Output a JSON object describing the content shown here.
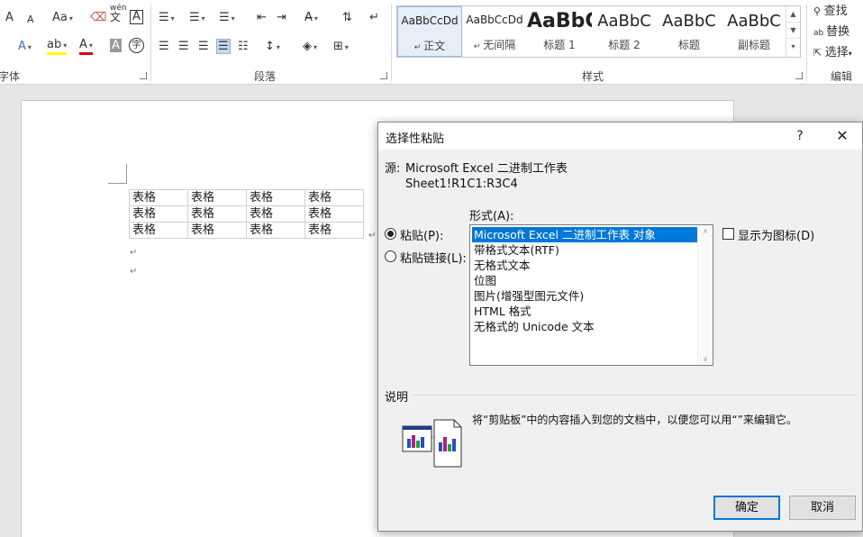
{
  "ribbon": {
    "group_labels": {
      "font": "字体",
      "paragraph": "段落",
      "styles": "样式",
      "editing": "编辑"
    },
    "font_controls": {
      "grow": "A",
      "shrink": "A",
      "case": "Aa",
      "phonetic_top": "wén",
      "phonetic_bottom": "文",
      "border_char": "A",
      "text_effects": "A",
      "highlight": "ab",
      "font_color": "A",
      "char_shading": "A",
      "enclose": "字"
    },
    "styles": [
      {
        "sample": "AaBbCcDd",
        "name": "正文",
        "selected": true
      },
      {
        "sample": "AaBbCcDd",
        "name": "无间隔",
        "selected": false
      },
      {
        "sample": "AaBbC",
        "name": "标题 1",
        "selected": false
      },
      {
        "sample": "AaBbC",
        "name": "标题 2",
        "selected": false
      },
      {
        "sample": "AaBbC",
        "name": "标题",
        "selected": false
      },
      {
        "sample": "AaBbC",
        "name": "副标题",
        "selected": false
      }
    ],
    "editing": {
      "find": "查找",
      "replace": "替换",
      "select": "选择"
    }
  },
  "document": {
    "table": [
      [
        "表格",
        "表格",
        "表格",
        "表格"
      ],
      [
        "表格",
        "表格",
        "表格",
        "表格"
      ],
      [
        "表格",
        "表格",
        "表格",
        "表格"
      ]
    ],
    "paragraph_mark": "↵"
  },
  "dialog": {
    "title": "选择性粘贴",
    "help": "?",
    "close": "✕",
    "source_label": "源:",
    "source_value": "Microsoft Excel 二进制工作表",
    "source_range": "Sheet1!R1C1:R3C4",
    "format_label": "形式(A):",
    "paste_option": {
      "label": "粘贴(P):",
      "checked": true
    },
    "paste_link_option": {
      "label": "粘贴链接(L):",
      "checked": false
    },
    "formats": [
      "Microsoft Excel 二进制工作表 对象",
      "带格式文本(RTF)",
      "无格式文本",
      "位图",
      "图片(增强型图元文件)",
      "HTML 格式",
      "无格式的 Unicode 文本"
    ],
    "selected_format_index": 0,
    "display_as_icon": {
      "label": "显示为图标(D)",
      "checked": false
    },
    "description_label": "说明",
    "description_text": "将“剪贴板”中的内容插入到您的文档中，以便您可以用“”来编辑它。",
    "ok": "确定",
    "cancel": "取消",
    "colors": {
      "selection": "#0078d7",
      "ok_border": "#0078d7"
    }
  }
}
